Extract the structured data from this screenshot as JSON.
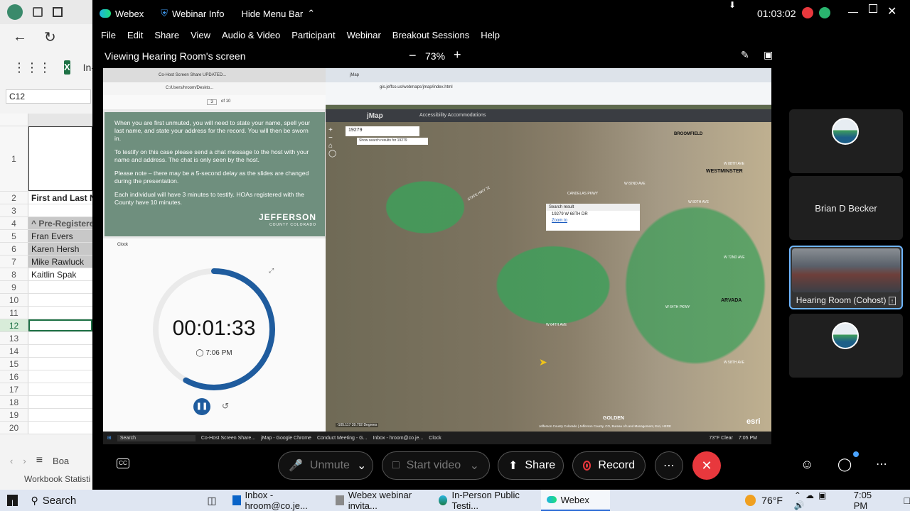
{
  "excel": {
    "name_box": "C12",
    "tab_label": "In-",
    "header_cell": "First and Last Na",
    "rows": [
      {
        "n": "1",
        "v": ""
      },
      {
        "n": "2",
        "v": "First and Last Na"
      },
      {
        "n": "3",
        "v": ""
      },
      {
        "n": "4",
        "v": "^ Pre-Registered"
      },
      {
        "n": "5",
        "v": "Fran Evers"
      },
      {
        "n": "6",
        "v": "Karen Hersh"
      },
      {
        "n": "7",
        "v": "Mike Rawluck"
      },
      {
        "n": "8",
        "v": "Kaitlin Spak"
      },
      {
        "n": "9",
        "v": ""
      },
      {
        "n": "10",
        "v": ""
      },
      {
        "n": "11",
        "v": ""
      },
      {
        "n": "12",
        "v": ""
      },
      {
        "n": "13",
        "v": ""
      },
      {
        "n": "14",
        "v": ""
      },
      {
        "n": "15",
        "v": ""
      },
      {
        "n": "16",
        "v": ""
      },
      {
        "n": "17",
        "v": ""
      },
      {
        "n": "18",
        "v": ""
      },
      {
        "n": "19",
        "v": ""
      },
      {
        "n": "20",
        "v": ""
      }
    ],
    "sheet_tab": "Boa",
    "status": "Workbook Statisti"
  },
  "webex": {
    "app_name": "Webex",
    "webinar_info": "Webinar Info",
    "hide_menu": "Hide Menu Bar",
    "timer": "01:03:02",
    "menu": [
      "File",
      "Edit",
      "Share",
      "View",
      "Audio & Video",
      "Participant",
      "Webinar",
      "Breakout Sessions",
      "Help"
    ],
    "viewing": "Viewing Hearing Room's screen",
    "zoom": "73%"
  },
  "shared": {
    "ppt_tab": "Co-Host Screen Share UPDATED...",
    "ppt_path": "C:/Users/hroom/Deskto...",
    "ppt_page": "3",
    "ppt_of": "of 10",
    "slide_p1": "When you are first unmuted, you will need to state your name, spell your last name, and state your address for the record. You will then be sworn in.",
    "slide_p2": "To testify on this case please send a chat message to the host with your name and address. The chat is only seen by the host.",
    "slide_p3": "Please note – there may be a 5-second delay as the slides are changed during the presentation.",
    "slide_p4": "Each individual will have 3 minutes to testify. HOAs registered with the County have 10 minutes.",
    "slide_logo": "JEFFERSON",
    "slide_logo_sub": "COUNTY COLORADO",
    "clock_title": "Clock",
    "clock_time": "00:01:33",
    "clock_alarm": "7:06 PM",
    "clock_progress": 0.58,
    "map_tab": "jMap",
    "map_url": "gis.jeffco.us/webmaps/jmap/index.html",
    "map_title": "jMap",
    "map_accessibility": "Accessibility Accommodations",
    "map_search": "19279",
    "map_search_hint": "Show search results for 19279",
    "search_result_title": "Search result",
    "search_result_addr": "19279 W 68TH DR",
    "search_result_zoom": "Zoom to",
    "places": [
      "WESTMINSTER",
      "ARVADA",
      "BROOMFIELD",
      "GOLDEN"
    ],
    "roads": [
      "W 88TH AVE",
      "W 80TH AVE",
      "W 72ND AVE",
      "W 64TH AVE",
      "W 58TH AVE",
      "STATE HWY 72",
      "CANDELAS PKWY",
      "W 82ND AVE",
      "W 64TH PKWY"
    ],
    "map_coords": "-105.117 39.792 Degrees",
    "map_credit": "Jefferson County Colorado | Jefferson County, CO, Bureau of Land Management, Esri, HERE",
    "esri": "esri",
    "inner_search": "Search",
    "inner_apps": [
      "Co-Host Screen Share...",
      "jMap - Google Chrome",
      "Conduct Meeting - G...",
      "Inbox - hroom@co.je...",
      "Clock"
    ],
    "inner_weather": "73°F Clear",
    "inner_time": "7:05 PM"
  },
  "participants": [
    {
      "name": "",
      "type": "logo"
    },
    {
      "name": "Brian D Becker",
      "type": "name"
    },
    {
      "name": "Hearing Room (Cohost)",
      "type": "video"
    },
    {
      "name": "",
      "type": "logo"
    }
  ],
  "controls": {
    "unmute": "Unmute",
    "start_video": "Start video",
    "share": "Share",
    "record": "Record"
  },
  "taskbar": {
    "search": "Search",
    "apps": [
      "Inbox - hroom@co.je...",
      "Webex webinar invita...",
      "In-Person Public Testi...",
      "Webex"
    ],
    "weather": "76°F",
    "time": "7:05 PM"
  },
  "colors": {
    "record_red": "#e8383d",
    "slide_green": "#6f8f7e",
    "clock_blue": "#1f5c9e",
    "map_green": "#3f9e5a"
  }
}
